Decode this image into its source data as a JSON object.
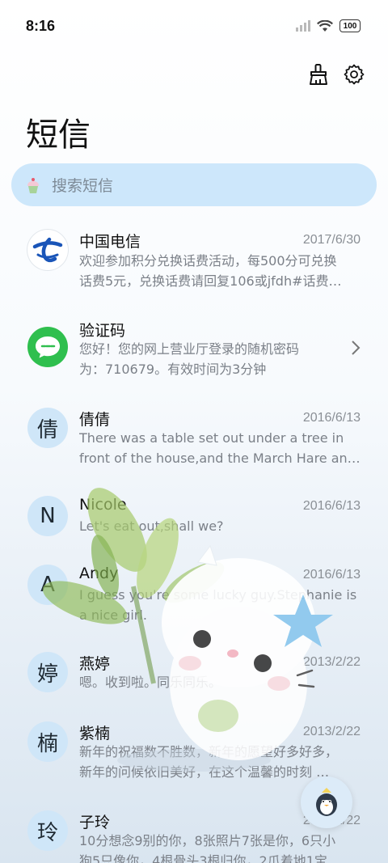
{
  "status_bar": {
    "time": "8:16",
    "battery": "100"
  },
  "header": {
    "title": "短信"
  },
  "search": {
    "placeholder": "搜索短信"
  },
  "conversations": [
    {
      "name": "中国电信",
      "date": "2017/6/30",
      "lines": [
        "欢迎参加积分兑换话费活动，每500分可兑换",
        "话费5元，兑换话费请回复106或jfdh#话费…"
      ],
      "avatar": ""
    },
    {
      "name": "验证码",
      "date": "",
      "lines": [
        "您好！您的网上营业厅登录的随机密码",
        "为：710679。有效时间为3分钟"
      ],
      "avatar": ""
    },
    {
      "name": "倩倩",
      "date": "2016/6/13",
      "lines": [
        "There was a table set out under a tree in",
        "front of the house,and the March Hare an…"
      ],
      "avatar": "倩"
    },
    {
      "name": "Nicole",
      "date": "2016/6/13",
      "lines": [
        "Let's eat out,shall we?"
      ],
      "avatar": "N"
    },
    {
      "name": "Andy",
      "date": "2016/6/13",
      "lines": [
        "I guess you're some lucky guy.Stephanie is",
        "a nice girl."
      ],
      "avatar": "A"
    },
    {
      "name": "燕婷",
      "date": "2013/2/22",
      "lines": [
        "嗯。收到啦。同乐同乐。"
      ],
      "avatar": "婷"
    },
    {
      "name": "紫楠",
      "date": "2013/2/22",
      "lines": [
        "新年的祝福数不胜数，新年的愿望好多好多，",
        "新年的问候依旧美好，在这个温馨的时刻 …"
      ],
      "avatar": "楠"
    },
    {
      "name": "子玲",
      "date": "2013/2/22",
      "lines": [
        "10分想念9别的你，8张照片7张是你，6只小",
        "狗5只像你，4根骨头3根归你，2爪着地1宝"
      ],
      "avatar": "玲"
    }
  ],
  "colors": {
    "search_bg": "#cde7fb",
    "avatar_bg": "#cfe6f8",
    "telecom_blue": "#1a55b8",
    "sms_green": "#2fbf4e"
  }
}
